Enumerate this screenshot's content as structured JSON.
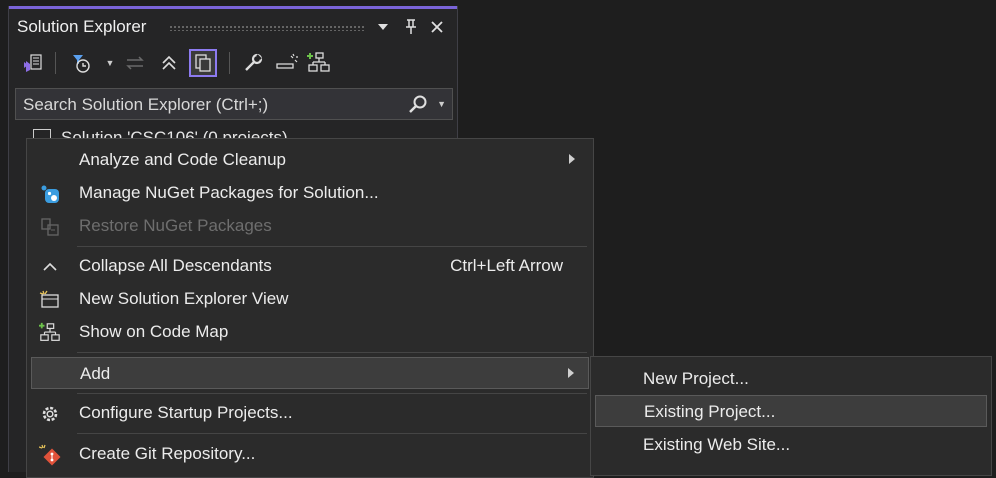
{
  "panel": {
    "title": "Solution Explorer",
    "search_placeholder": "Search Solution Explorer (Ctrl+;)",
    "solution_label": "Solution 'CSC106' (0 projects)"
  },
  "toolbar_icons": [
    "vs-switch-views-icon",
    "pending-changes-filter-icon",
    "sync-icon",
    "collapse-all-icon",
    "show-all-files-icon",
    "properties-icon",
    "preview-icon",
    "code-map-icon"
  ],
  "context_menu": {
    "items": [
      {
        "label": "Analyze and Code Cleanup",
        "shortcut": "",
        "submenu": true,
        "enabled": true
      },
      {
        "label": "Manage NuGet Packages for Solution...",
        "shortcut": "",
        "submenu": false,
        "enabled": true
      },
      {
        "label": "Restore NuGet Packages",
        "shortcut": "",
        "submenu": false,
        "enabled": false
      },
      {
        "label": "Collapse All Descendants",
        "shortcut": "Ctrl+Left Arrow",
        "submenu": false,
        "enabled": true
      },
      {
        "label": "New Solution Explorer View",
        "shortcut": "",
        "submenu": false,
        "enabled": true
      },
      {
        "label": "Show on Code Map",
        "shortcut": "",
        "submenu": false,
        "enabled": true
      },
      {
        "label": "Add",
        "shortcut": "",
        "submenu": true,
        "enabled": true
      },
      {
        "label": "Configure Startup Projects...",
        "shortcut": "",
        "submenu": false,
        "enabled": true
      },
      {
        "label": "Create Git Repository...",
        "shortcut": "",
        "submenu": false,
        "enabled": true
      }
    ]
  },
  "add_submenu": {
    "items": [
      {
        "label": "New Project..."
      },
      {
        "label": "Existing Project..."
      },
      {
        "label": "Existing Web Site..."
      }
    ]
  },
  "colors": {
    "accent": "#7a64d8",
    "background": "#1e1e1e",
    "menu_bg": "#2b2b2b",
    "hover_bg": "#3d3d3d",
    "nuget_blue": "#3b9de0",
    "git_red": "#e0523a"
  }
}
